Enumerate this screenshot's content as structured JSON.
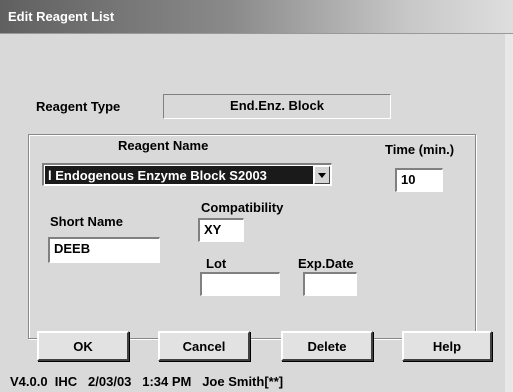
{
  "window": {
    "title": "Edit Reagent List"
  },
  "reagent_type": {
    "label": "Reagent Type",
    "value": "End.Enz. Block"
  },
  "reagent_name": {
    "label": "Reagent Name",
    "selected": "l Endogenous Enzyme Block S2003"
  },
  "time": {
    "label": "Time (min.)",
    "value": "10"
  },
  "short_name": {
    "label": "Short Name",
    "value": "DEEB"
  },
  "compatibility": {
    "label": "Compatibility",
    "value": "XY"
  },
  "lot": {
    "label": "Lot",
    "value": ""
  },
  "exp_date": {
    "label": "Exp.Date",
    "value": ""
  },
  "buttons": {
    "ok": "OK",
    "cancel": "Cancel",
    "delete": "Delete",
    "help": "Help"
  },
  "status_bar": {
    "text": "V4.0.0  IHC   2/03/03   1:34 PM   Joe Smith[**]"
  }
}
